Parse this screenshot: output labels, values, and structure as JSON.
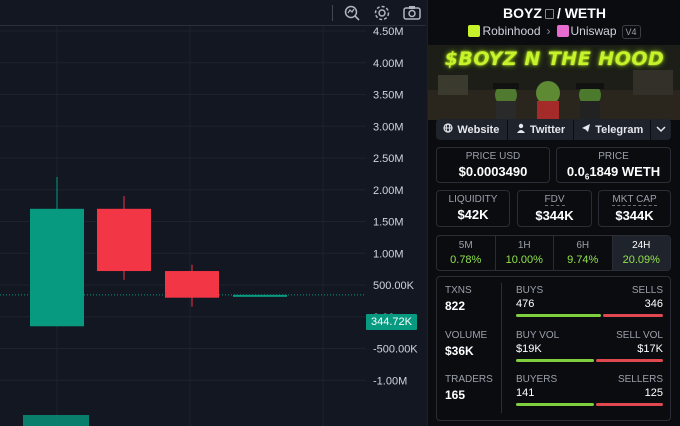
{
  "chart": {
    "y_axis_labels": [
      "4.50M",
      "4.00M",
      "3.50M",
      "3.00M",
      "2.50M",
      "2.00M",
      "1.50M",
      "1.00M",
      "500.00K",
      "0.00",
      "-500.00K",
      "-1.00M"
    ],
    "current_price_label": "344.72K",
    "colors": {
      "up": "#089981",
      "down": "#f23645",
      "bg": "#131722",
      "grid": "#1e222d"
    },
    "toolbar_icons": [
      "indicator-search-icon",
      "gear-icon",
      "camera-icon"
    ]
  },
  "chart_data": {
    "type": "candlestick",
    "unit": "market cap (USD)",
    "ylim": [
      -1250000,
      4800000
    ],
    "candles": [
      {
        "open": -150000,
        "close": 1700000,
        "high": 2200000,
        "low": -150000,
        "color": "up"
      },
      {
        "open": 1700000,
        "close": 720000,
        "high": 1900000,
        "low": 580000,
        "color": "down"
      },
      {
        "open": 720000,
        "close": 300000,
        "high": 820000,
        "low": 160000,
        "color": "down"
      },
      {
        "open": 344720,
        "close": 344720,
        "high": 344720,
        "low": 344720,
        "color": "up"
      }
    ],
    "current_value": 344720
  },
  "header": {
    "base": "BOYZ",
    "separator": "/",
    "quote": "WETH",
    "chain": "Robinhood",
    "dex": "Uniswap",
    "version": "V4"
  },
  "banner": {
    "title": "$BOYZ N THE HOOD"
  },
  "links": [
    {
      "label": "Website",
      "icon": "globe-icon"
    },
    {
      "label": "Twitter",
      "icon": "user-icon"
    },
    {
      "label": "Telegram",
      "icon": "telegram-icon"
    }
  ],
  "price": {
    "usd_label": "PRICE USD",
    "usd_value": "$0.0003490",
    "native_label": "PRICE",
    "native_prefix": "0.0",
    "native_subscript": "6",
    "native_suffix": "1849 WETH"
  },
  "metrics": [
    {
      "label": "LIQUIDITY",
      "value": "$42K"
    },
    {
      "label": "FDV",
      "value": "$344K"
    },
    {
      "label": "MKT CAP",
      "value": "$344K"
    }
  ],
  "timeframes": [
    {
      "label": "5M",
      "value": "0.78%"
    },
    {
      "label": "1H",
      "value": "10.00%"
    },
    {
      "label": "6H",
      "value": "9.74%"
    },
    {
      "label": "24H",
      "value": "20.09%"
    }
  ],
  "stats": {
    "txns_label": "TXNS",
    "txns_value": "822",
    "volume_label": "VOLUME",
    "volume_value": "$36K",
    "traders_label": "TRADERS",
    "traders_value": "165",
    "buys_label": "BUYS",
    "buys_value": "476",
    "sells_label": "SELLS",
    "sells_value": "346",
    "buyvol_label": "BUY VOL",
    "buyvol_value": "$19K",
    "sellvol_label": "SELL VOL",
    "sellvol_value": "$17K",
    "buyers_label": "BUYERS",
    "buyers_value": "141",
    "sellers_label": "SELLERS",
    "sellers_value": "125",
    "buys_fraction": 0.579,
    "buyvol_fraction": 0.528,
    "buyers_fraction": 0.53
  }
}
